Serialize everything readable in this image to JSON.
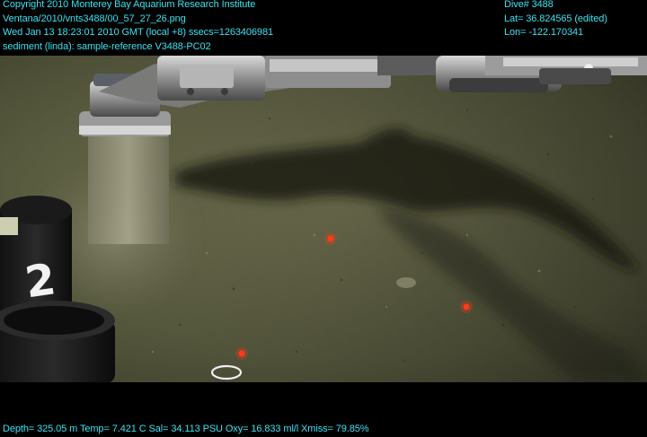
{
  "overlay": {
    "top_left": [
      "Copyright 2010 Monterey Bay Aquarium Research Institute",
      "Ventana/2010/vnts3488/00_57_27_26.png",
      "Wed Jan 13 18:23:01 2010 GMT (local +8)  ssecs=1263406981",
      "sediment (linda): sample-reference V3488-PC02"
    ],
    "top_right": [
      "Dive# 3488",
      "Lat= 36.824565 (edited)",
      "Lon= -122.170341"
    ],
    "bottom": "Depth= 325.05 m  Temp= 7.421 C  Sal= 34.113 PSU  Oxy= 16.833 ml/l  Xmiss= 79.85%",
    "color": "#36e3f2"
  },
  "scene": {
    "core_label": "2"
  }
}
